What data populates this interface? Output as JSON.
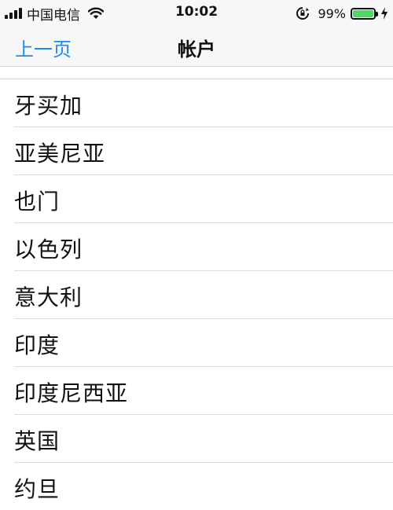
{
  "status_bar": {
    "carrier": "中国电信",
    "time": "10:02",
    "battery_percent": "99%",
    "battery_level": 0.99,
    "battery_color": "#4cd964"
  },
  "nav": {
    "back_label": "上一页",
    "title": "帐户"
  },
  "countries": [
    {
      "label": "牙买加"
    },
    {
      "label": "亚美尼亚"
    },
    {
      "label": "也门"
    },
    {
      "label": "以色列"
    },
    {
      "label": "意大利"
    },
    {
      "label": "印度"
    },
    {
      "label": "印度尼西亚"
    },
    {
      "label": "英国"
    },
    {
      "label": "约旦"
    }
  ],
  "colors": {
    "accent": "#1b8cf2"
  }
}
